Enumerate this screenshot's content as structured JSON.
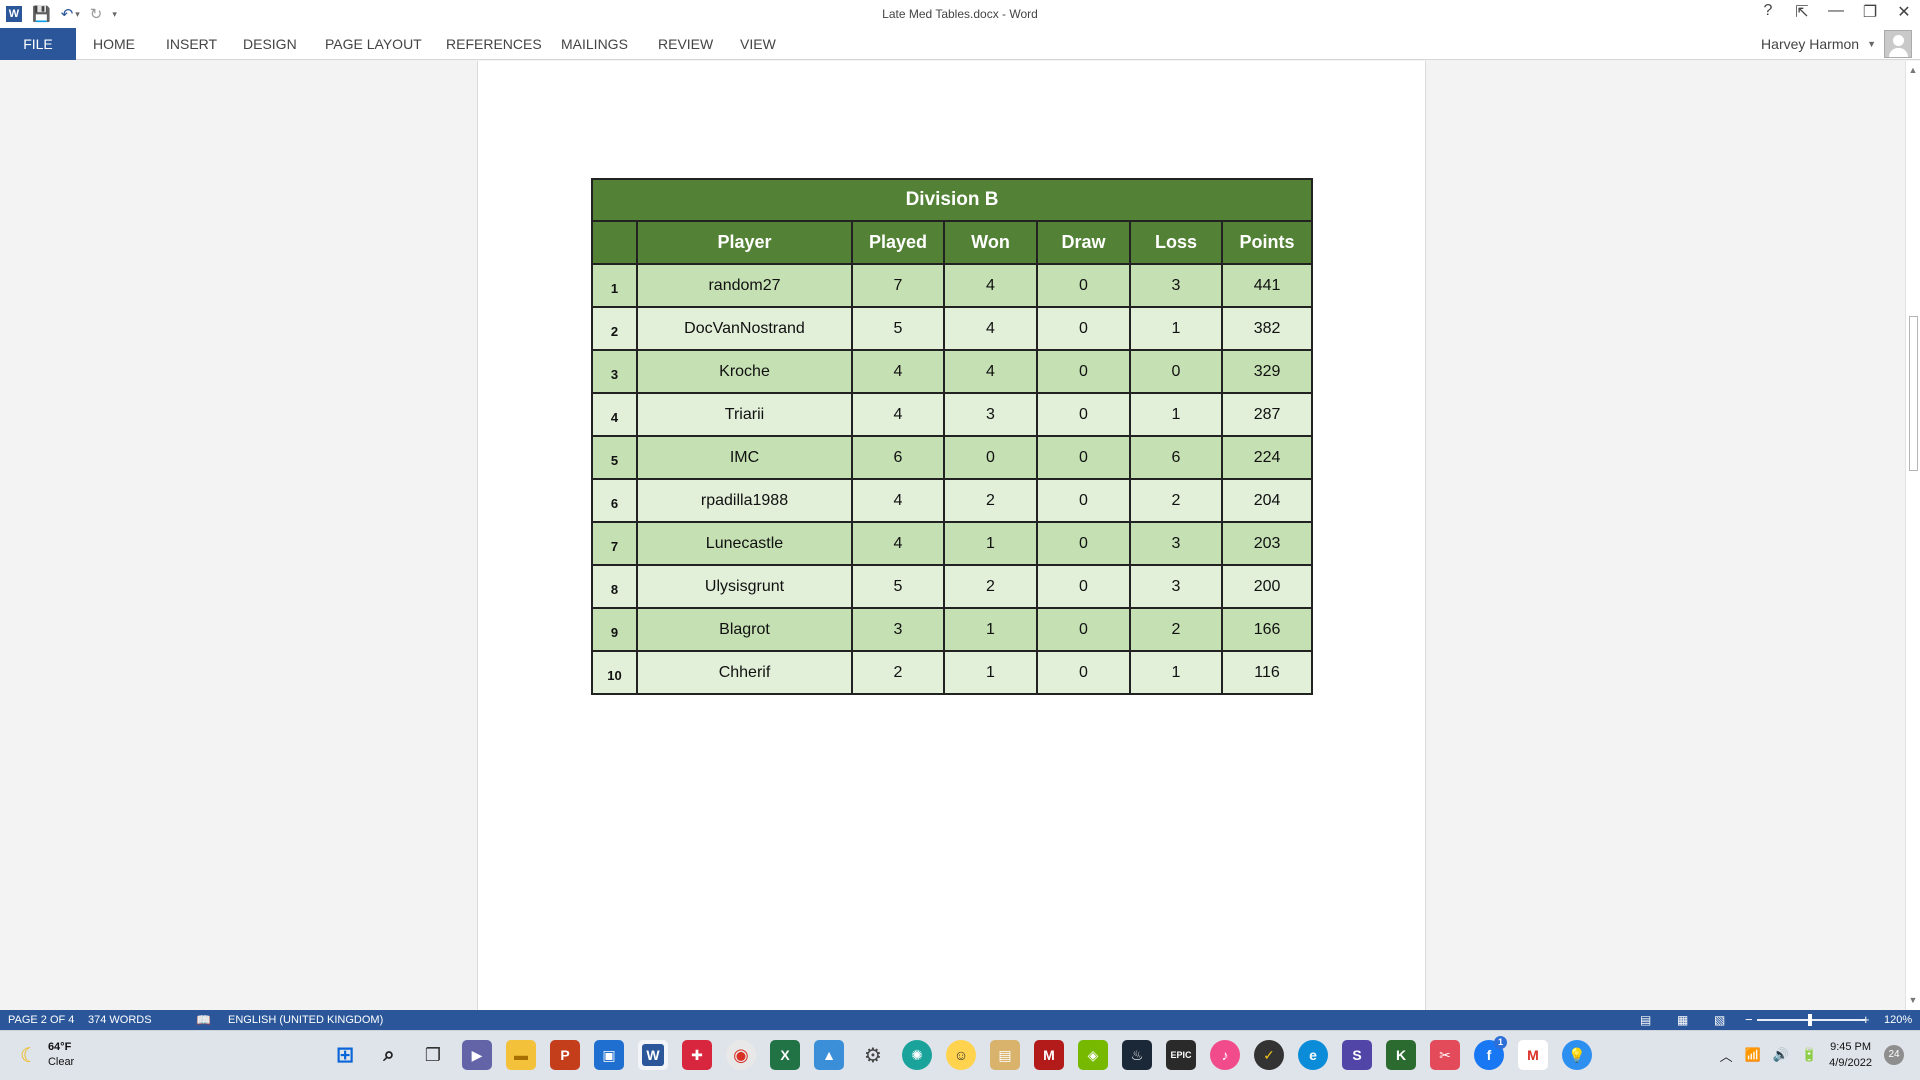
{
  "window": {
    "title": "Late Med Tables.docx - Word",
    "controls": [
      "?",
      "⇱",
      "—",
      "❐",
      "✕"
    ]
  },
  "qat": {
    "icons": [
      "word-logo-icon",
      "save-icon",
      "undo-icon",
      "redo-icon",
      "customize-icon"
    ]
  },
  "ribbon": {
    "tabs": [
      "FILE",
      "HOME",
      "INSERT",
      "DESIGN",
      "PAGE LAYOUT",
      "REFERENCES",
      "MAILINGS",
      "REVIEW",
      "VIEW"
    ],
    "user_name": "Harvey Harmon"
  },
  "table": {
    "caption": "Division B",
    "headers": [
      "",
      "Player",
      "Played",
      "Won",
      "Draw",
      "Loss",
      "Points"
    ],
    "rows": [
      [
        "1",
        "random27",
        "7",
        "4",
        "0",
        "3",
        "441"
      ],
      [
        "2",
        "DocVanNostrand",
        "5",
        "4",
        "0",
        "1",
        "382"
      ],
      [
        "3",
        "Kroche",
        "4",
        "4",
        "0",
        "0",
        "329"
      ],
      [
        "4",
        "Triarii",
        "4",
        "3",
        "0",
        "1",
        "287"
      ],
      [
        "5",
        "IMC",
        "6",
        "0",
        "0",
        "6",
        "224"
      ],
      [
        "6",
        "rpadilla1988",
        "4",
        "2",
        "0",
        "2",
        "204"
      ],
      [
        "7",
        "Lunecastle",
        "4",
        "1",
        "0",
        "3",
        "203"
      ],
      [
        "8",
        "Ulysisgrunt",
        "5",
        "2",
        "0",
        "3",
        "200"
      ],
      [
        "9",
        "Blagrot",
        "3",
        "1",
        "0",
        "2",
        "166"
      ],
      [
        "10",
        "Chherif",
        "2",
        "1",
        "0",
        "1",
        "116"
      ]
    ],
    "header_color": "#538135",
    "row_colors": [
      "#c5e0b3",
      "#e2efd9"
    ]
  },
  "statusbar": {
    "page": "PAGE 2 OF 4",
    "words": "374 WORDS",
    "language": "ENGLISH (UNITED KINGDOM)",
    "zoom": "120%"
  },
  "taskbar": {
    "weather_temp": "64°F",
    "weather_desc": "Clear",
    "time": "9:45 PM",
    "date": "4/9/2022",
    "notifications": "24",
    "fb_badge": "1"
  }
}
